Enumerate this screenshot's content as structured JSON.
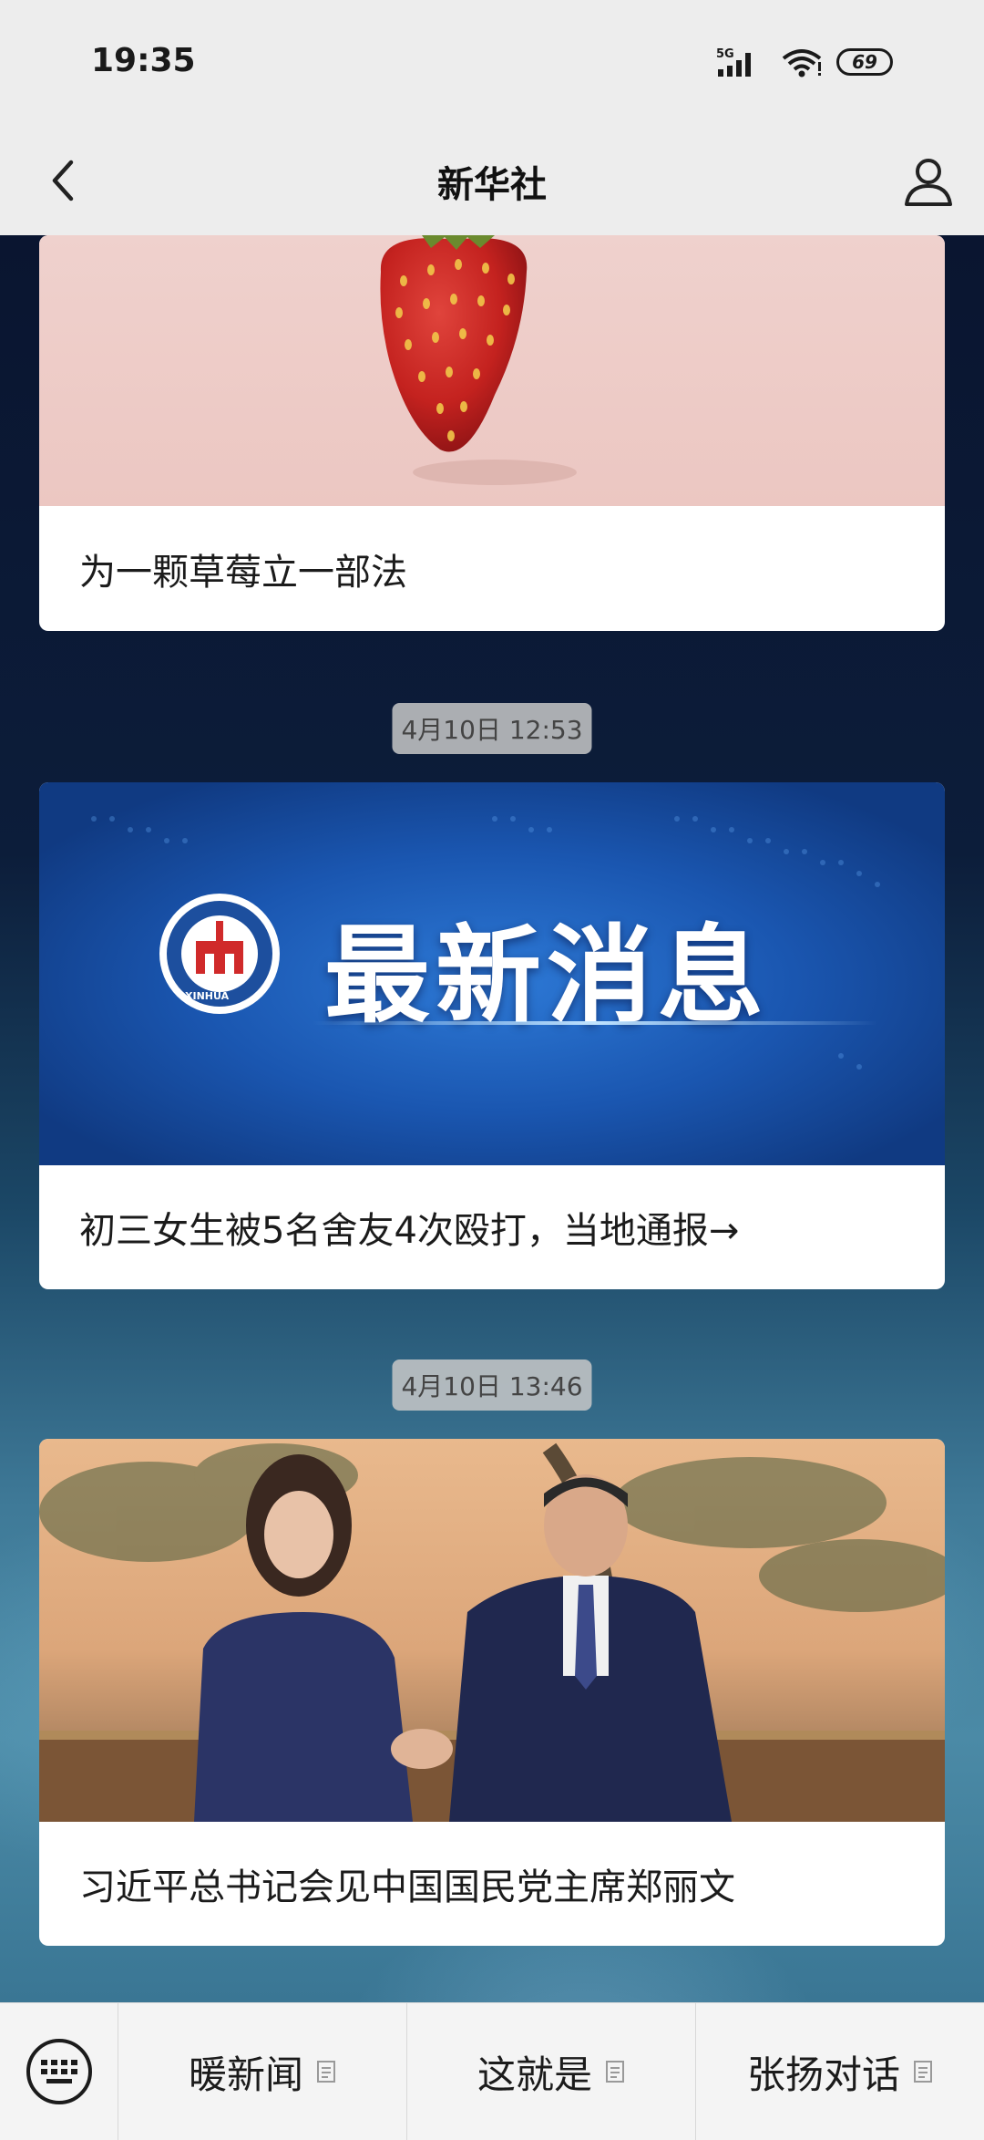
{
  "status_bar": {
    "time": "19:35",
    "network": "5G",
    "battery": "69"
  },
  "nav": {
    "title": "新华社",
    "back_icon": "chevron-left-icon",
    "profile_icon": "person-icon"
  },
  "feed": {
    "items": [
      {
        "title": "为一颗草莓立一部法",
        "image": "strawberry-photo"
      },
      {
        "timestamp": "4月10日 12:53",
        "banner_text": "最新消息",
        "logo_caption": "XINHUA",
        "title": "初三女生被5名舍友4次殴打，当地通报→"
      },
      {
        "timestamp": "4月10日 13:46",
        "title": "习近平总书记会见中国国民党主席郑丽文",
        "image": "handshake-photo"
      }
    ]
  },
  "bottom_menu": {
    "keyboard_icon": "keyboard-icon",
    "items": [
      {
        "label": "暖新闻",
        "icon": "submenu-icon"
      },
      {
        "label": "这就是",
        "icon": "submenu-icon"
      },
      {
        "label": "张扬对话",
        "icon": "submenu-icon"
      }
    ]
  },
  "colors": {
    "bar_bg": "#ededed",
    "banner_blue": "#1a56b0",
    "strawberry_red": "#c8272a"
  }
}
